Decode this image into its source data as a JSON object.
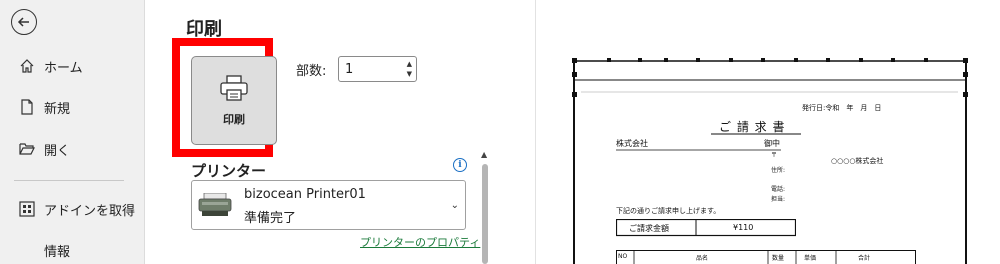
{
  "sidebar": {
    "items": [
      {
        "label": "ホーム",
        "icon": "home-icon"
      },
      {
        "label": "新規",
        "icon": "new-document-icon"
      },
      {
        "label": "開く",
        "icon": "open-folder-icon"
      },
      {
        "label": "アドインを取得",
        "icon": "addins-icon"
      },
      {
        "label": "情報",
        "icon": ""
      }
    ]
  },
  "main": {
    "title": "印刷",
    "print_button_label": "印刷",
    "copies_label": "部数:",
    "copies_value": "1",
    "printer_heading": "プリンター",
    "printer_name": "bizocean Printer01",
    "printer_status": "準備完了",
    "printer_properties_link": "プリンターのプロパティ"
  },
  "preview": {
    "issue_date": "発行日:令和　年　月　日",
    "doc_title": "ご 請 求 書",
    "company_label": "株式会社",
    "honorific": "御中",
    "postal_mark": "〒",
    "address_label": "住所:",
    "sender_name": "○○○○株式会社",
    "phone_label": "電話:",
    "person_label": "担当:",
    "notice": "下記の通りご請求申し上げます。",
    "amount_label": "ご請求金額",
    "amount_value": "¥110",
    "table_headers": [
      "NO",
      "品名",
      "数量",
      "単価",
      "合計"
    ]
  },
  "colors": {
    "highlight": "#ff0000",
    "link": "#1a7a3a",
    "info": "#1a6fc4"
  }
}
